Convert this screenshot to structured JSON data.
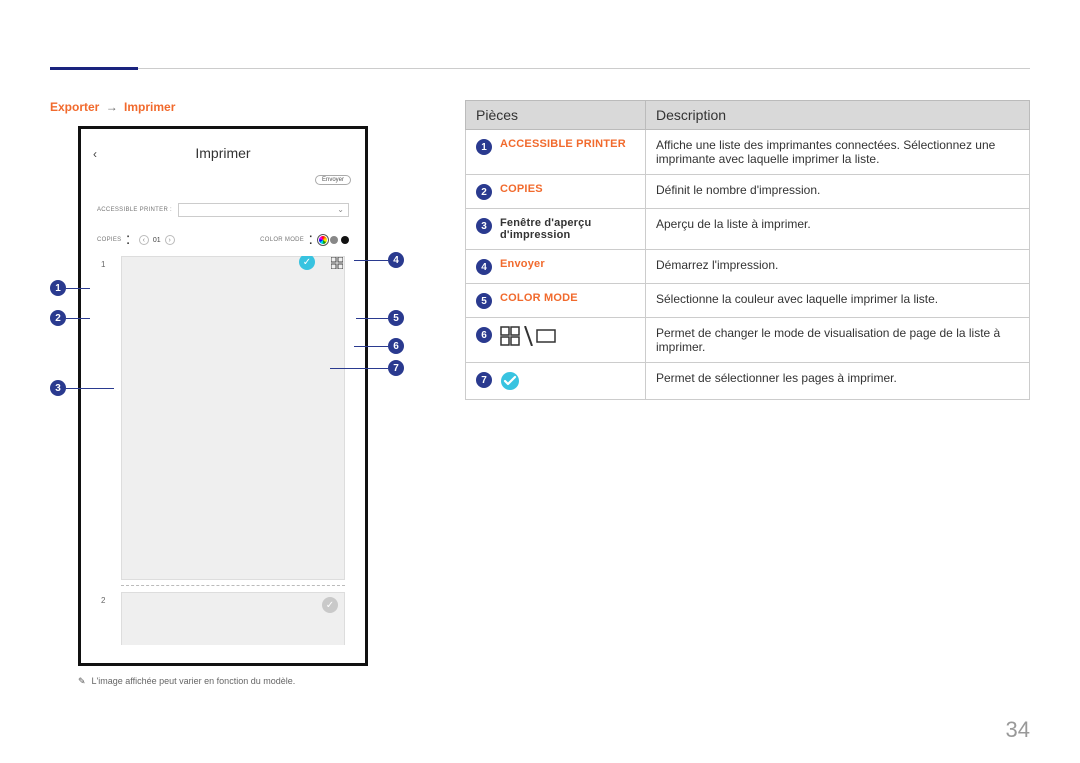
{
  "breadcrumb": {
    "exporter": "Exporter",
    "imprimer": "Imprimer"
  },
  "device": {
    "title": "Imprimer",
    "send": "Envoyer",
    "printer_label": "ACCESSIBLE PRINTER :",
    "copies_label": "COPIES",
    "copies_value": "01",
    "color_label": "COLOR MODE",
    "page1_num": "1",
    "page2_num": "2"
  },
  "footnote": "L'image affichée peut varier en fonction du modèle.",
  "table": {
    "head_pieces": "Pièces",
    "head_desc": "Description",
    "rows": [
      {
        "n": "1",
        "name": "ACCESSIBLE PRINTER",
        "orange": true,
        "desc": "Affiche une liste des imprimantes connectées. Sélectionnez une imprimante avec laquelle imprimer la liste."
      },
      {
        "n": "2",
        "name": "COPIES",
        "orange": true,
        "desc": "Définit le nombre d'impression."
      },
      {
        "n": "3",
        "name": "Fenêtre d'aperçu d'impression",
        "orange": false,
        "desc": "Aperçu de la liste à imprimer."
      },
      {
        "n": "4",
        "name": "Envoyer",
        "orange": true,
        "desc": "Démarrez l'impression."
      },
      {
        "n": "5",
        "name": "COLOR MODE",
        "orange": true,
        "desc": "Sélectionne la couleur avec laquelle imprimer la liste."
      },
      {
        "n": "6",
        "name": "",
        "orange": false,
        "desc": "Permet de changer le mode de visualisation de page de la liste à imprimer.",
        "icon": "view-toggle"
      },
      {
        "n": "7",
        "name": "",
        "orange": false,
        "desc": "Permet de sélectionner les pages à imprimer.",
        "icon": "check"
      }
    ]
  },
  "page_number": "34"
}
